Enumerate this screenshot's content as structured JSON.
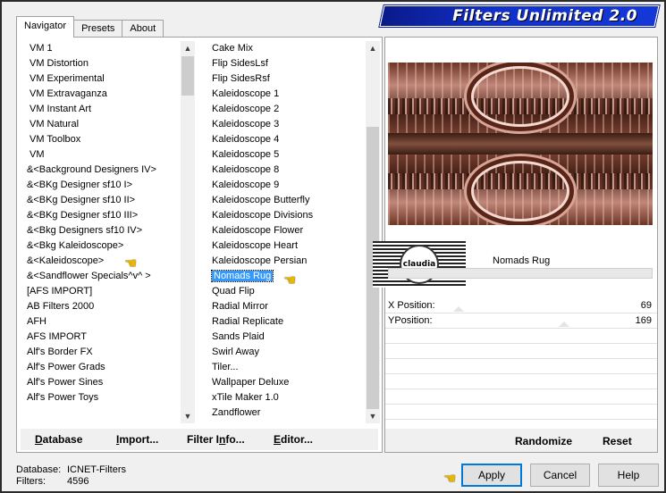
{
  "title": "Filters Unlimited 2.0",
  "tabs": [
    {
      "label": "Navigator",
      "active": true
    },
    {
      "label": "Presets",
      "active": false
    },
    {
      "label": "About",
      "active": false
    }
  ],
  "categories": [
    "VM 1",
    "VM Distortion",
    "VM Experimental",
    "VM Extravaganza",
    "VM Instant Art",
    "VM Natural",
    "VM Toolbox",
    "VM",
    "&<Background Designers IV>",
    "&<BKg Designer sf10 I>",
    "&<BKg Designer sf10 II>",
    "&<BKg Designer sf10 III>",
    "&<Bkg Designers sf10 IV>",
    "&<Bkg Kaleidoscope>",
    "&<Kaleidoscope>",
    "&<Sandflower Specials^v^ >",
    "[AFS IMPORT]",
    "AB Filters 2000",
    "AFH",
    "AFS IMPORT",
    "Alf's Border FX",
    "Alf's Power Grads",
    "Alf's Power Sines",
    "Alf's Power Toys"
  ],
  "selected_category": "&<Bkg Kaleidoscope>",
  "filters": [
    "Cake Mix",
    "Flip SidesLsf",
    "Flip SidesRsf",
    "Kaleidoscope 1",
    "Kaleidoscope 2",
    "Kaleidoscope 3",
    "Kaleidoscope 4",
    "Kaleidoscope 5",
    "Kaleidoscope 8",
    "Kaleidoscope 9",
    "Kaleidoscope Butterfly",
    "Kaleidoscope Divisions",
    "Kaleidoscope Flower",
    "Kaleidoscope Heart",
    "Kaleidoscope Persian",
    "Nomads Rug",
    "Quad Flip",
    "Radial Mirror",
    "Radial Replicate",
    "Sands Plaid",
    "Swirl Away",
    "Tiler...",
    "Wallpaper Deluxe",
    "xTile Maker 1.0",
    "Zandflower"
  ],
  "selected_filter": "Nomads Rug",
  "list_buttons": {
    "database": {
      "pre": "D",
      "post": "atabase"
    },
    "import": {
      "pre": "I",
      "post": "mport..."
    },
    "filter_info": {
      "pre": "Filter I",
      "u": "n",
      "post": "fo..."
    },
    "editor": {
      "pre": "E",
      "post": "ditor..."
    }
  },
  "preview": {
    "filter_name": "Nomads Rug",
    "logo_text": "claudia"
  },
  "params": [
    {
      "label": "X Position:",
      "value": "69"
    },
    {
      "label": "YPosition:",
      "value": "169"
    },
    {
      "label": "",
      "value": ""
    },
    {
      "label": "",
      "value": ""
    },
    {
      "label": "",
      "value": ""
    },
    {
      "label": "",
      "value": ""
    },
    {
      "label": "",
      "value": ""
    },
    {
      "label": "",
      "value": ""
    }
  ],
  "right_buttons": {
    "randomize": "Randomize",
    "reset": "Reset"
  },
  "status": {
    "database_label": "Database:",
    "database_value": "ICNET-Filters",
    "filters_label": "Filters:",
    "filters_value": "4596"
  },
  "dialog_buttons": {
    "apply": "Apply",
    "cancel": "Cancel",
    "help": "Help"
  },
  "icons": {
    "pointer": "pointing-hand-icon",
    "scroll_up": "arrow-up-icon",
    "scroll_down": "arrow-down-icon"
  },
  "colors": {
    "selection": "#3399ff",
    "banner": "#1030c8",
    "pointer": "#e8b800"
  }
}
